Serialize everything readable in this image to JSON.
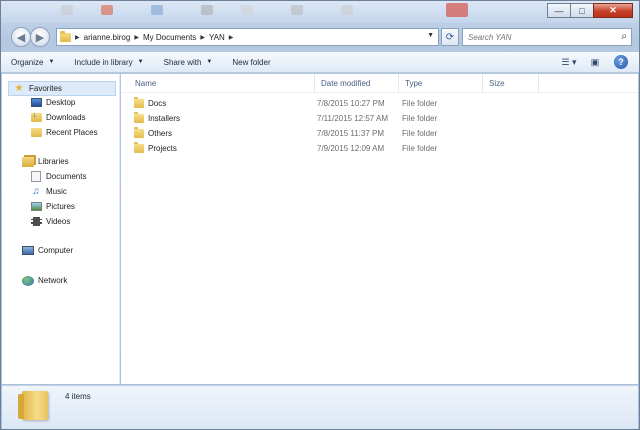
{
  "window": {
    "buttons": {
      "minimize": "—",
      "maximize": "□",
      "close": "✕"
    }
  },
  "address": {
    "crumbs": [
      "arianne.birog",
      "My Documents",
      "YAN"
    ],
    "search_placeholder": "Search YAN"
  },
  "toolbar": {
    "organize": "Organize",
    "include_in_library": "Include in library",
    "share_with": "Share with",
    "new_folder": "New folder"
  },
  "navigation": {
    "favorites": {
      "label": "Favorites",
      "items": [
        "Desktop",
        "Downloads",
        "Recent Places"
      ]
    },
    "libraries": {
      "label": "Libraries",
      "items": [
        "Documents",
        "Music",
        "Pictures",
        "Videos"
      ]
    },
    "computer": "Computer",
    "network": "Network"
  },
  "columns": {
    "name": "Name",
    "date_modified": "Date modified",
    "type": "Type",
    "size": "Size"
  },
  "files": [
    {
      "name": "Docs",
      "date": "7/8/2015 10:27 PM",
      "type": "File folder"
    },
    {
      "name": "Installers",
      "date": "7/11/2015 12:57 AM",
      "type": "File folder"
    },
    {
      "name": "Others",
      "date": "7/8/2015 11:37 PM",
      "type": "File folder"
    },
    {
      "name": "Projects",
      "date": "7/9/2015 12:09 AM",
      "type": "File folder"
    }
  ],
  "details": {
    "item_count": "4 items"
  },
  "icons": {
    "back": "back-arrow-icon",
    "forward": "forward-arrow-icon",
    "refresh": "refresh-icon",
    "search": "search-icon",
    "help": "help-icon",
    "views": "views-icon",
    "preview": "preview-pane-icon"
  }
}
